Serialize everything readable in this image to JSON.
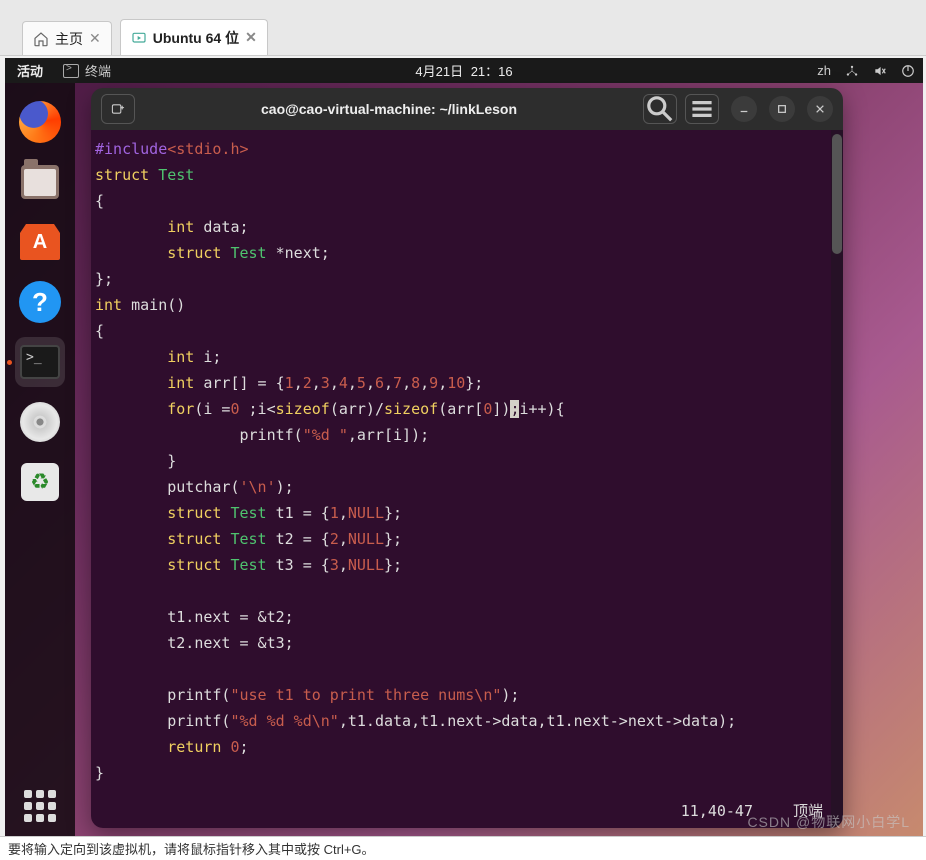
{
  "vmwareTabs": {
    "home": "主页",
    "vm": "Ubuntu 64 位"
  },
  "topbar": {
    "activities": "活动",
    "terminalLabel": "终端",
    "date": "4月21日",
    "time": "21：16",
    "lang": "zh"
  },
  "dock": {
    "items": [
      "firefox",
      "files",
      "software",
      "help",
      "terminal",
      "disc",
      "trash"
    ],
    "active": "terminal"
  },
  "terminal": {
    "title": "cao@cao-virtual-machine: ~/linkLeson",
    "status": {
      "pos": "11,40-47",
      "scroll": "顶端"
    },
    "code": {
      "include_directive": "#include",
      "include_header": "<stdio.h>",
      "kw_struct": "struct",
      "ty_Test": "Test",
      "kw_int": "int",
      "field_data": "data;",
      "field_next": "*next;",
      "main_sig_open": "main()",
      "arr_decl_prefix": "arr[] = {",
      "arr_vals": [
        "1",
        "2",
        "3",
        "4",
        "5",
        "6",
        "7",
        "8",
        "9",
        "10"
      ],
      "for_prefix": "(i =",
      "for_zero": "0",
      "for_mid1": " ;i<",
      "sizeof": "sizeof",
      "for_arr_a": "(arr)/",
      "for_arr_b": "(arr[",
      "for_idx0": "0",
      "for_tail": "])",
      "for_caret": ";",
      "for_end": "i++){",
      "printf1_fmt": "\"%d \"",
      "printf1_tail": ",arr[i]);",
      "putchar_arg": "'\\n'",
      "t1_val": "1",
      "t2_val": "2",
      "t3_val": "3",
      "null": "NULL",
      "assign_t1": "t1.next = &t2;",
      "assign_t2": "t2.next = &t3;",
      "printf2_fmt": "\"use t1 to print three nums\\n\"",
      "printf3_fmt": "\"%d %d %d\\n\"",
      "printf3_tail": ",t1.data,t1.next->data,t1.next->next->data);",
      "return_kw": "return",
      "return_val": "0"
    }
  },
  "statusbar": {
    "hint": "要将输入定向到该虚拟机，请将鼠标指针移入其中或按 Ctrl+G。"
  },
  "watermark": "CSDN @物联网小白学L"
}
